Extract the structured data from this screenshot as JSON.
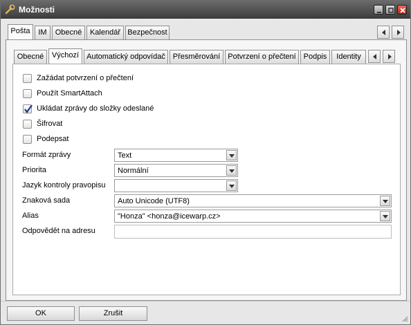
{
  "window": {
    "title": "Možnosti"
  },
  "outer_tabs": [
    "Pošta",
    "IM",
    "Obecné",
    "Kalendář",
    "Bezpečnost"
  ],
  "inner_tabs": [
    "Obecné",
    "Výchozí",
    "Automatický odpovídač",
    "Přesměrování",
    "Potvrzení o přečtení",
    "Podpis",
    "Identity"
  ],
  "active_outer_tab": "Pošta",
  "active_inner_tab": "Výchozí",
  "checkboxes": [
    {
      "label": "Zažádat potvrzení o přečtení",
      "checked": false
    },
    {
      "label": "Použít SmartAttach",
      "checked": false
    },
    {
      "label": "Ukládat zprávy do složky odeslané",
      "checked": true
    },
    {
      "label": "Šifrovat",
      "checked": false
    },
    {
      "label": "Podepsat",
      "checked": false
    }
  ],
  "fields": {
    "format": {
      "label": "Formát zprávy",
      "value": "Text"
    },
    "priority": {
      "label": "Priorita",
      "value": "Normální"
    },
    "spellcheck": {
      "label": "Jazyk kontroly pravopisu",
      "value": ""
    },
    "charset": {
      "label": "Znaková sada",
      "value": "Auto Unicode (UTF8)"
    },
    "alias": {
      "label": "Alias",
      "value": "\"Honza\" <honza@icewarp.cz>"
    },
    "reply_to": {
      "label": "Odpovědět na adresu",
      "value": ""
    }
  },
  "buttons": {
    "ok": "OK",
    "cancel": "Zrušit"
  },
  "icons": {
    "app": "wrench-icon",
    "minimize": "minimize-icon",
    "maximize": "maximize-icon",
    "close": "close-icon",
    "scroll_left": "chevron-left-icon",
    "scroll_right": "chevron-right-icon",
    "dropdown": "chevron-down-icon",
    "check": "checkmark-icon"
  },
  "colors": {
    "titlebar": "#4a4a4a",
    "close_button": "#d2382a",
    "check_mark": "#1a3a8a"
  }
}
